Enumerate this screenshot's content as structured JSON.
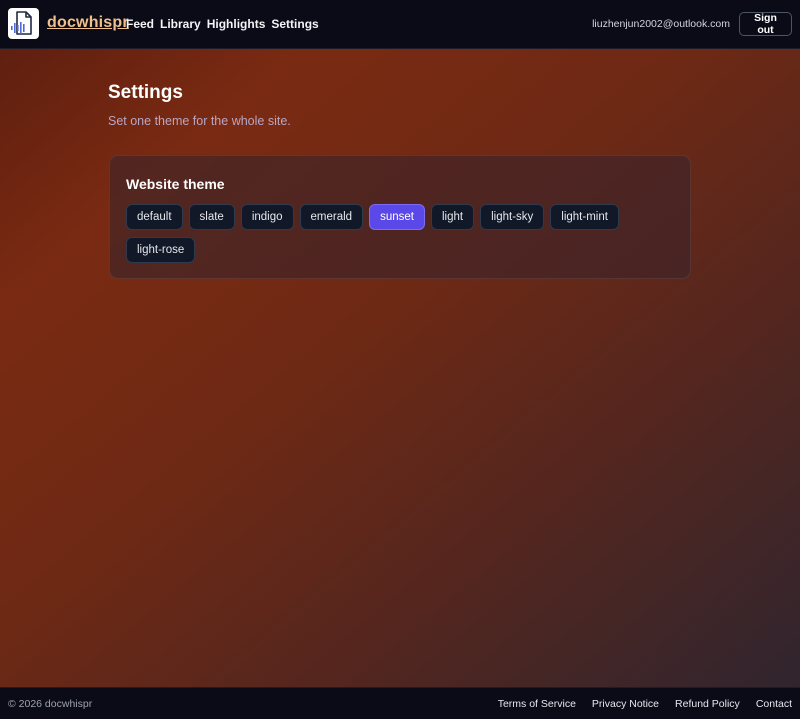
{
  "header": {
    "brand": "docwhispr",
    "logo_icon": "document-audio-icon",
    "nav": [
      "Feed",
      "Library",
      "Highlights",
      "Settings"
    ],
    "user_email": "liuzhenjun2002@outlook.com",
    "signout_label": "Sign out"
  },
  "main": {
    "title": "Settings",
    "subtitle": "Set one theme for the whole site.",
    "theme_card": {
      "title": "Website theme",
      "options": [
        "default",
        "slate",
        "indigo",
        "emerald",
        "sunset",
        "light",
        "light-sky",
        "light-mint",
        "light-rose"
      ],
      "selected": "sunset"
    }
  },
  "footer": {
    "copyright": "© 2026 docwhispr",
    "links": [
      "Terms of Service",
      "Privacy Notice",
      "Refund Policy",
      "Contact"
    ]
  },
  "colors": {
    "header_bg": "#0b0b18",
    "brand": "#f0c08a",
    "accent": "#5b48e8",
    "chip_bg": "#111827"
  }
}
